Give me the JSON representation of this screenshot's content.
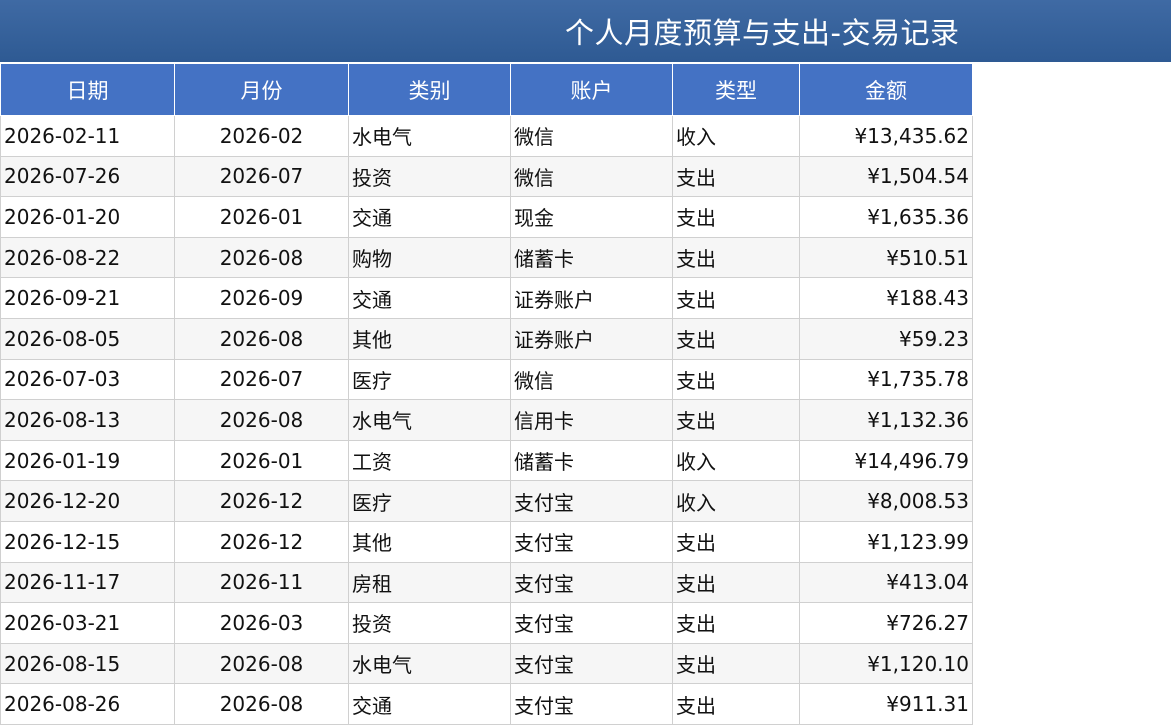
{
  "sheet": {
    "title": "个人月度预算与支出-交易记录",
    "columns": [
      "日期",
      "月份",
      "类别",
      "账户",
      "类型",
      "金额"
    ],
    "rows": [
      {
        "date": "2026-02-11",
        "month": "2026-02",
        "category": "水电气",
        "account": "微信",
        "type": "收入",
        "amount": "¥13,435.62"
      },
      {
        "date": "2026-07-26",
        "month": "2026-07",
        "category": "投资",
        "account": "微信",
        "type": "支出",
        "amount": "¥1,504.54"
      },
      {
        "date": "2026-01-20",
        "month": "2026-01",
        "category": "交通",
        "account": "现金",
        "type": "支出",
        "amount": "¥1,635.36"
      },
      {
        "date": "2026-08-22",
        "month": "2026-08",
        "category": "购物",
        "account": "储蓄卡",
        "type": "支出",
        "amount": "¥510.51"
      },
      {
        "date": "2026-09-21",
        "month": "2026-09",
        "category": "交通",
        "account": "证券账户",
        "type": "支出",
        "amount": "¥188.43"
      },
      {
        "date": "2026-08-05",
        "month": "2026-08",
        "category": "其他",
        "account": "证券账户",
        "type": "支出",
        "amount": "¥59.23"
      },
      {
        "date": "2026-07-03",
        "month": "2026-07",
        "category": "医疗",
        "account": "微信",
        "type": "支出",
        "amount": "¥1,735.78"
      },
      {
        "date": "2026-08-13",
        "month": "2026-08",
        "category": "水电气",
        "account": "信用卡",
        "type": "支出",
        "amount": "¥1,132.36"
      },
      {
        "date": "2026-01-19",
        "month": "2026-01",
        "category": "工资",
        "account": "储蓄卡",
        "type": "收入",
        "amount": "¥14,496.79"
      },
      {
        "date": "2026-12-20",
        "month": "2026-12",
        "category": "医疗",
        "account": "支付宝",
        "type": "收入",
        "amount": "¥8,008.53"
      },
      {
        "date": "2026-12-15",
        "month": "2026-12",
        "category": "其他",
        "account": "支付宝",
        "type": "支出",
        "amount": "¥1,123.99"
      },
      {
        "date": "2026-11-17",
        "month": "2026-11",
        "category": "房租",
        "account": "支付宝",
        "type": "支出",
        "amount": "¥413.04"
      },
      {
        "date": "2026-03-21",
        "month": "2026-03",
        "category": "投资",
        "account": "支付宝",
        "type": "支出",
        "amount": "¥726.27"
      },
      {
        "date": "2026-08-15",
        "month": "2026-08",
        "category": "水电气",
        "account": "支付宝",
        "type": "支出",
        "amount": "¥1,120.10"
      },
      {
        "date": "2026-08-26",
        "month": "2026-08",
        "category": "交通",
        "account": "支付宝",
        "type": "支出",
        "amount": "¥911.31"
      }
    ]
  },
  "colors": {
    "title_bar": "#2e5a93",
    "header": "#4472c4",
    "header_text": "#ffffff",
    "grid": "#d0d0d0"
  }
}
